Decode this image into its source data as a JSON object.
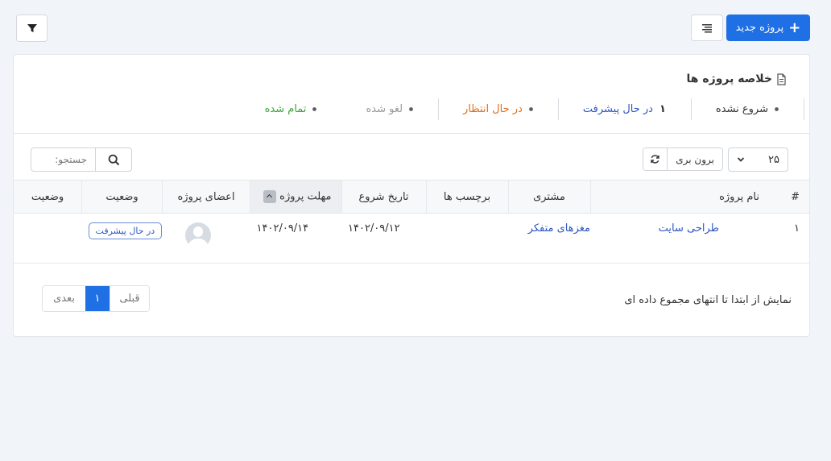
{
  "toolbar": {
    "new_project_label": "پروژه جدید",
    "plus_glyph": "+",
    "list_icon": "align-right-icon",
    "filter_icon": "filter-icon"
  },
  "summary": {
    "title": "خلاصه پروژه ها",
    "stats": [
      {
        "count": "",
        "label": "شروع نشده",
        "color": "#333333"
      },
      {
        "count": "۱",
        "label": "در حال پیشرفت",
        "color": "#2d57c2"
      },
      {
        "count": "",
        "label": "در حال انتظار",
        "color": "#e36c1b"
      },
      {
        "count": "",
        "label": "لغو شده",
        "color": "#999999"
      },
      {
        "count": "",
        "label": "تمام شده",
        "color": "#3aa53a"
      }
    ]
  },
  "controls": {
    "page_size": "۲۵",
    "export_label": "برون بری",
    "search_placeholder": "جستجو:"
  },
  "table": {
    "headers": [
      "#",
      "نام پروژه",
      "مشتری",
      "برچسب ها",
      "تاریخ شروع",
      "مهلت پروژه",
      "اعضای پروژه",
      "وضعیت",
      "وضعیت"
    ],
    "rows": [
      {
        "num": "۱",
        "name": "طراحی سایت",
        "client": "مغزهای متفکر",
        "tags": "",
        "start": "۱۴۰۲/۰۹/۱۲",
        "deadline": "۱۴۰۲/۰۹/۱۴",
        "status": "در حال پیشرفت"
      }
    ]
  },
  "footer": {
    "info": "نمایش از ابتدا تا انتهای مجموع داده ای",
    "prev": "قبلی",
    "current": "۱",
    "next": "بعدی"
  }
}
